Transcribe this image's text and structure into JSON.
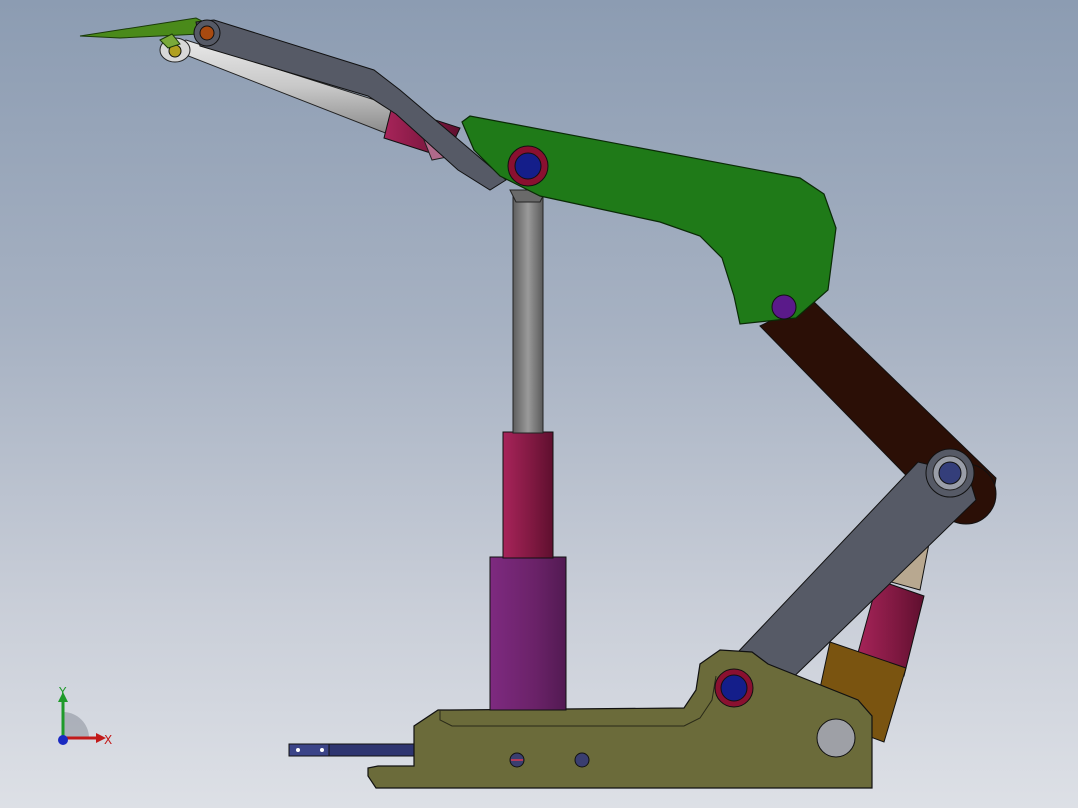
{
  "viewport": {
    "background_top": "#8c9cb2",
    "background_bottom": "#dde0e6"
  },
  "triad": {
    "x_label": "X",
    "y_label": "Y",
    "x_color": "#c21a1a",
    "y_color": "#1e9a2a",
    "z_color": "#1a2ac2"
  },
  "model": {
    "colors": {
      "base": "#6b6b3a",
      "boom": "#1f7a18",
      "link": "#565a66",
      "link_dark": "#2b0f06",
      "column_rod": "#7a7a7a",
      "cylinder_crimson": "#8e1f4a",
      "cylinder_purple": "#6a2a6a",
      "cylinder_brown": "#7a5410",
      "pin_outer": "#8a1030",
      "pin_inner": "#141e8a",
      "pin_violet": "#5a1a8a",
      "rod_silver": "#c9c9c9",
      "tip_green": "#5a9a20"
    }
  }
}
